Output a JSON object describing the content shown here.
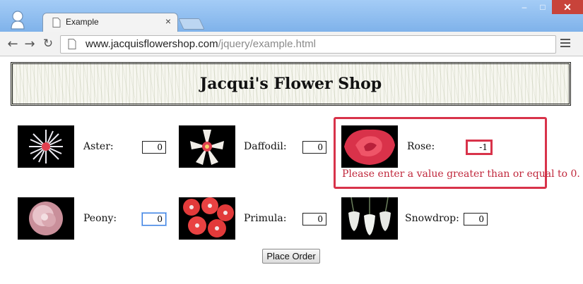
{
  "browser": {
    "tab_title": "Example",
    "tab_close": "×",
    "url_host": "www.jacquisflowershop.com",
    "url_path": "/jquery/example.html",
    "window_controls": {
      "minimize": "–",
      "maximize": "□",
      "close": "✕"
    },
    "icons": [
      "user-icon",
      "page-icon",
      "back-icon",
      "forward-icon",
      "reload-icon",
      "star-icon",
      "menu-icon"
    ]
  },
  "page": {
    "banner_title": "Jacqui's Flower Shop",
    "flowers": [
      {
        "name": "Aster",
        "label": "Aster:",
        "value": "0",
        "color": "#e8e8ee"
      },
      {
        "name": "Daffodil",
        "label": "Daffodil:",
        "value": "0",
        "color": "#f0ece6"
      },
      {
        "name": "Rose",
        "label": "Rose:",
        "value": "-1",
        "color": "#e0344a"
      },
      {
        "name": "Peony",
        "label": "Peony:",
        "value": "0",
        "color": "#d9a7b0"
      },
      {
        "name": "Primula",
        "label": "Primula:",
        "value": "0",
        "color": "#e23a3a"
      },
      {
        "name": "Snowdrop",
        "label": "Snowdrop:",
        "value": "0",
        "color": "#e6e8e4"
      }
    ],
    "error_message": "Please enter a value greater than or equal to 0.",
    "order_button": "Place Order",
    "colors": {
      "error": "#d8334a",
      "chrome": "#8fbdf0"
    }
  }
}
